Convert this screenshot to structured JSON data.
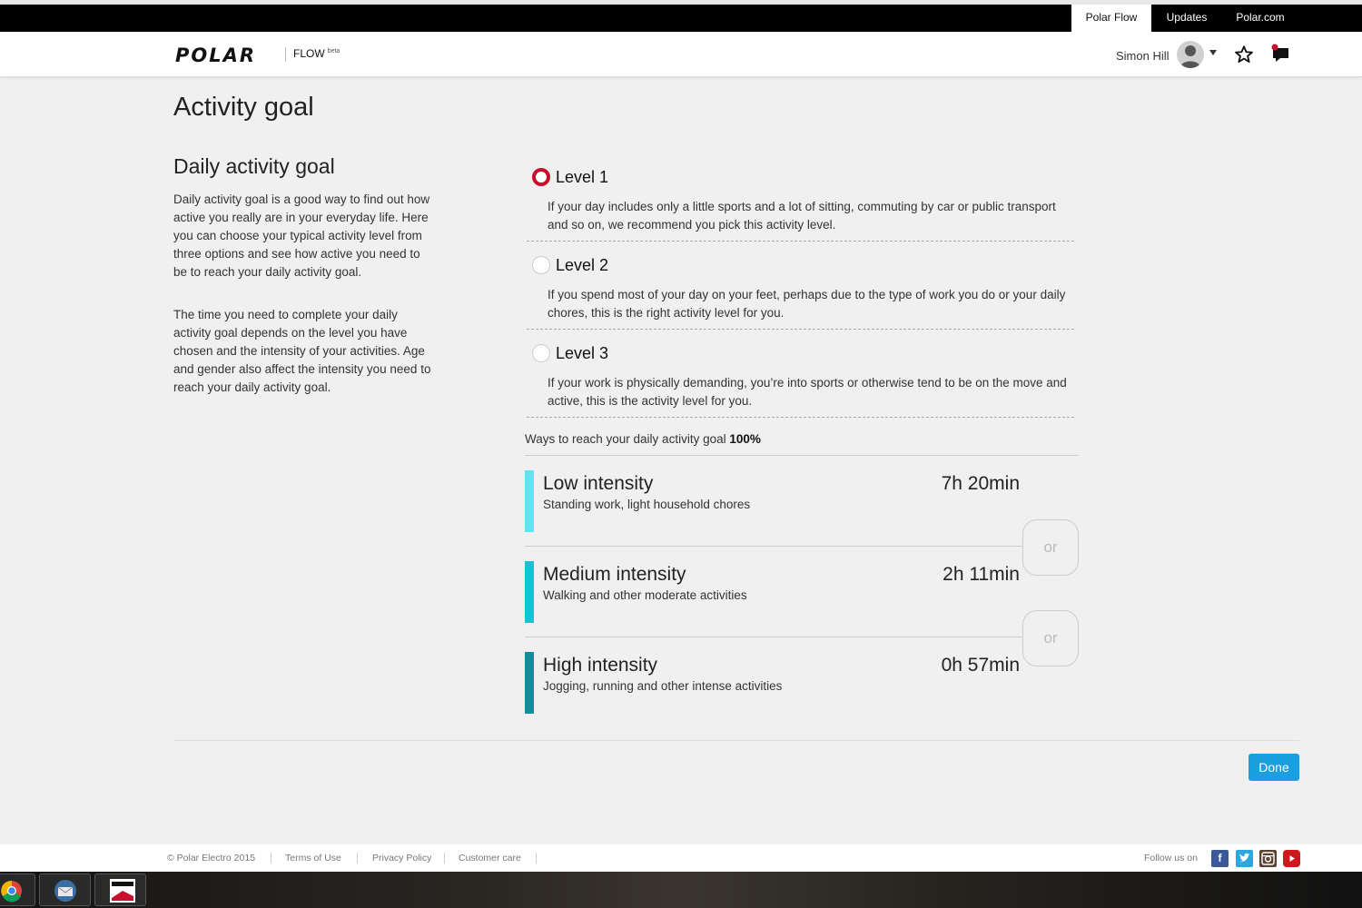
{
  "topnav": {
    "tabs": [
      "Polar Flow",
      "Updates",
      "Polar.com"
    ]
  },
  "header": {
    "logo": "POLAR",
    "product": "FLOW",
    "product_tag": "beta",
    "username": "Simon Hill"
  },
  "page": {
    "title": "Activity goal",
    "side_title": "Daily activity goal",
    "side_p1": "Daily activity goal is a good way to find out how active you really are in your everyday life. Here you can choose your typical activity level from three options and see how active you need to be to reach your daily activity goal.",
    "side_p2": "The time you need to complete your daily activity goal depends on the level you have chosen and the intensity of your activities. Age and gender also affect the intensity you need to reach your daily activity goal."
  },
  "levels": [
    {
      "label": "Level 1",
      "desc": "If your day includes only a little sports and a lot of sitting, commuting by car or public transport and so on, we recommend you pick this activity level.",
      "selected": true
    },
    {
      "label": "Level 2",
      "desc": "If you spend most of your day on your feet, perhaps due to the type of work you do or your daily chores, this is the right activity level for you.",
      "selected": false
    },
    {
      "label": "Level 3",
      "desc": "If your work is physically demanding, you’re into sports or otherwise tend to be on the move and active, this is the activity level for you.",
      "selected": false
    }
  ],
  "ways": {
    "text": "Ways to reach your daily activity goal",
    "percent": "100%"
  },
  "intensities": [
    {
      "name": "Low intensity",
      "desc": "Standing work, light household chores",
      "duration": "7h 20min",
      "color": "#5ce6f5"
    },
    {
      "name": "Medium intensity",
      "desc": "Walking and other moderate activities",
      "duration": "2h 11min",
      "color": "#12c3d4"
    },
    {
      "name": "High intensity",
      "desc": "Jogging, running and other intense activities",
      "duration": "0h 57min",
      "color": "#0a8f9c"
    }
  ],
  "or_label": "or",
  "done_label": "Done",
  "footer": {
    "copyright": "© Polar Electro 2015",
    "links": [
      "Terms of Use",
      "Privacy Policy",
      "Customer care"
    ],
    "follow": "Follow us on",
    "social_icons": [
      "facebook-icon",
      "twitter-icon",
      "instagram-icon",
      "youtube-icon"
    ]
  },
  "taskbar": {
    "apps": [
      "chrome-icon",
      "thunderbird-icon",
      "polar-flowsync-icon"
    ]
  },
  "colors": {
    "accent_red": "#c8102e",
    "button_blue": "#1b9fe0"
  }
}
